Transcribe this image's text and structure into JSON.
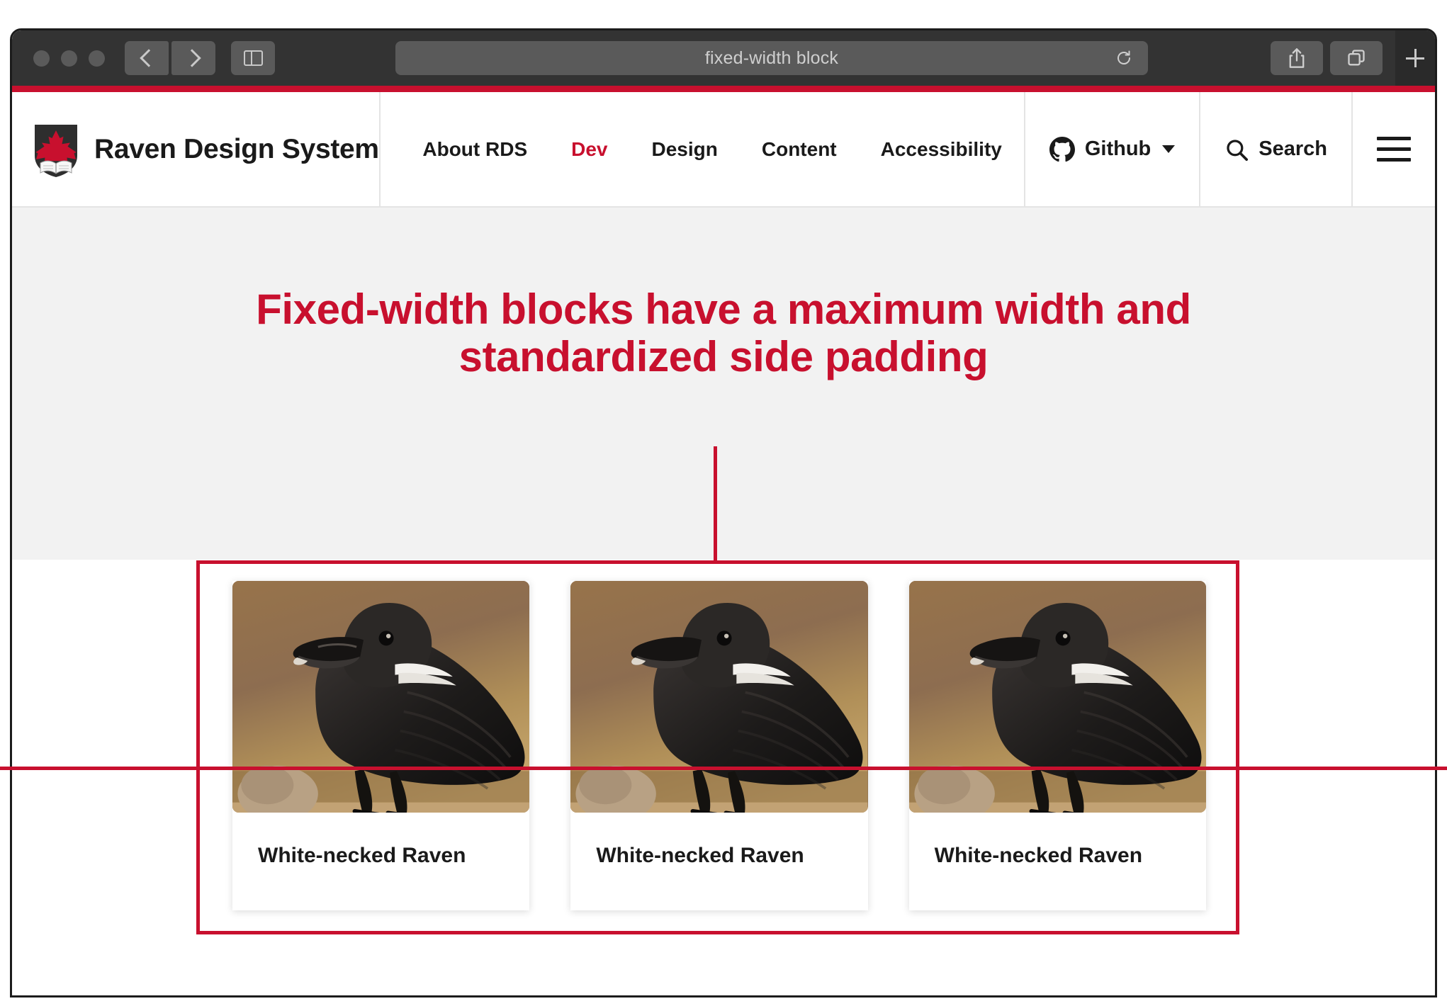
{
  "browser": {
    "address_value": "fixed-width block",
    "back_icon": "chevron-left-icon",
    "forward_icon": "chevron-right-icon",
    "sidebar_icon": "sidebar-toggle-icon",
    "reload_icon": "reload-icon",
    "share_icon": "share-icon",
    "tabs_icon": "tab-overview-icon",
    "newtab_icon": "plus-icon",
    "traffic_lights": [
      "close",
      "minimize",
      "zoom"
    ]
  },
  "site_header": {
    "logo_icon": "carleton-shield-logo",
    "brand_title": "Raven Design System",
    "nav": [
      {
        "label": "About RDS",
        "active": false
      },
      {
        "label": "Dev",
        "active": true
      },
      {
        "label": "Design",
        "active": false
      },
      {
        "label": "Content",
        "active": false
      },
      {
        "label": "Accessibility",
        "active": false
      }
    ],
    "github": {
      "label": "Github",
      "icon": "github-icon",
      "caret": "chevron-down-icon"
    },
    "search": {
      "label": "Search",
      "icon": "search-icon"
    },
    "menu": {
      "icon": "hamburger-menu-icon"
    }
  },
  "hero": {
    "heading_line1": "Fixed-width blocks have a maximum width",
    "heading_line2": "and standardized side padding",
    "heading_full": "Fixed-width blocks have a maximum width and standardized side padding"
  },
  "cards": [
    {
      "title": "White-necked Raven",
      "image": "white-necked-raven-photo"
    },
    {
      "title": "White-necked Raven",
      "image": "white-necked-raven-photo"
    },
    {
      "title": "White-necked Raven",
      "image": "white-necked-raven-photo"
    }
  ],
  "annotation": {
    "vertical_leader": "fixed-width-block-leader-line",
    "horizontal_rule": "full-bleed-reference-line",
    "highlight_box": "fixed-width-block-outline"
  },
  "colors": {
    "brand_red": "#c8102e",
    "hero_bg": "#f2f2f2",
    "text": "#1a1a1a",
    "chrome_bg": "#333333",
    "chrome_control": "#5a5a5a"
  }
}
